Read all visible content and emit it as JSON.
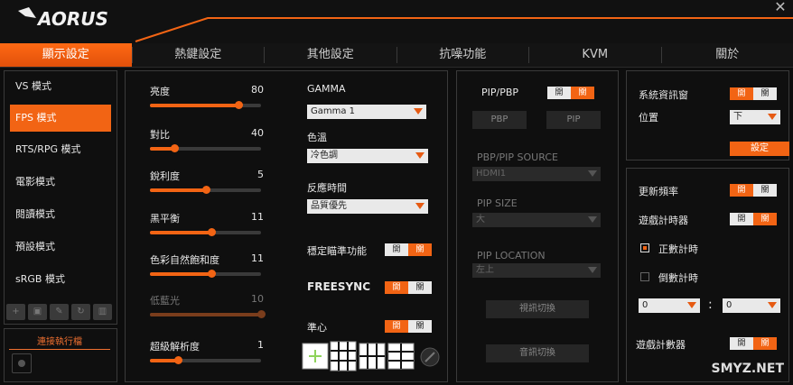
{
  "app": {
    "brand": "AORUS"
  },
  "tabs": [
    {
      "label": "顯示設定",
      "active": true
    },
    {
      "label": "熱鍵設定"
    },
    {
      "label": "其他設定"
    },
    {
      "label": "抗噪功能"
    },
    {
      "label": "KVM"
    },
    {
      "label": "關於"
    }
  ],
  "modes": [
    {
      "label": "VS 模式"
    },
    {
      "label": "FPS 模式",
      "active": true
    },
    {
      "label": "RTS/RPG 模式"
    },
    {
      "label": "電影模式"
    },
    {
      "label": "閱讀模式"
    },
    {
      "label": "預設模式"
    },
    {
      "label": "sRGB 模式"
    }
  ],
  "exec": {
    "title": "連接執行檔"
  },
  "sliders": [
    {
      "label": "亮度",
      "value": "80",
      "level": 0.8
    },
    {
      "label": "對比",
      "value": "40",
      "level": 0.22
    },
    {
      "label": "銳利度",
      "value": "5",
      "level": 0.5
    },
    {
      "label": "黑平衡",
      "value": "11",
      "level": 0.55
    },
    {
      "label": "色彩自然飽和度",
      "value": "11",
      "level": 0.55
    },
    {
      "label": "低藍光",
      "value": "10",
      "level": 1.0,
      "disabled": true
    },
    {
      "label": "超級解析度",
      "value": "1",
      "level": 0.25
    }
  ],
  "gamma": {
    "label": "GAMMA",
    "value": "Gamma 1"
  },
  "color_temp": {
    "label": "色溫",
    "value": "冷色調"
  },
  "response": {
    "label": "反應時間",
    "value": "品質優先"
  },
  "aim_stabilizer": {
    "label": "穩定瞄準功能",
    "on": "開",
    "off": "關"
  },
  "freesync": {
    "label": "FREESYNC",
    "on": "開",
    "off": "關"
  },
  "crosshair": {
    "label": "準心",
    "on": "開",
    "off": "關"
  },
  "pip": {
    "label": "PIP/PBP",
    "on": "開",
    "off": "關",
    "pbp_button": "PBP",
    "pip_button": "PIP",
    "source_label": "PBP/PIP SOURCE",
    "source_value": "HDMI1",
    "size_label": "PIP SIZE",
    "size_value": "大",
    "location_label": "PIP LOCATION",
    "location_value": "左上",
    "switch_video": "視訊切換",
    "switch_audio": "音訊切換"
  },
  "sysinfo": {
    "label": "系統資訊窗",
    "on": "開",
    "off": "關",
    "position_label": "位置",
    "position_value": "下",
    "settings_button": "設定"
  },
  "refresh": {
    "label": "更新頻率",
    "on": "開",
    "off": "關"
  },
  "game_timer": {
    "label": "遊戲計時器",
    "on": "開",
    "off": "關",
    "count_up": "正數計時",
    "count_down": "倒數計時",
    "minutes": "0",
    "seconds": "0",
    "sep": ":"
  },
  "game_counter": {
    "label": "遊戲計數器",
    "on": "開",
    "off": "關"
  },
  "watermark": "SMYZ.NET",
  "colors": {
    "accent": "#f26414",
    "background": "#0d0d0d"
  }
}
